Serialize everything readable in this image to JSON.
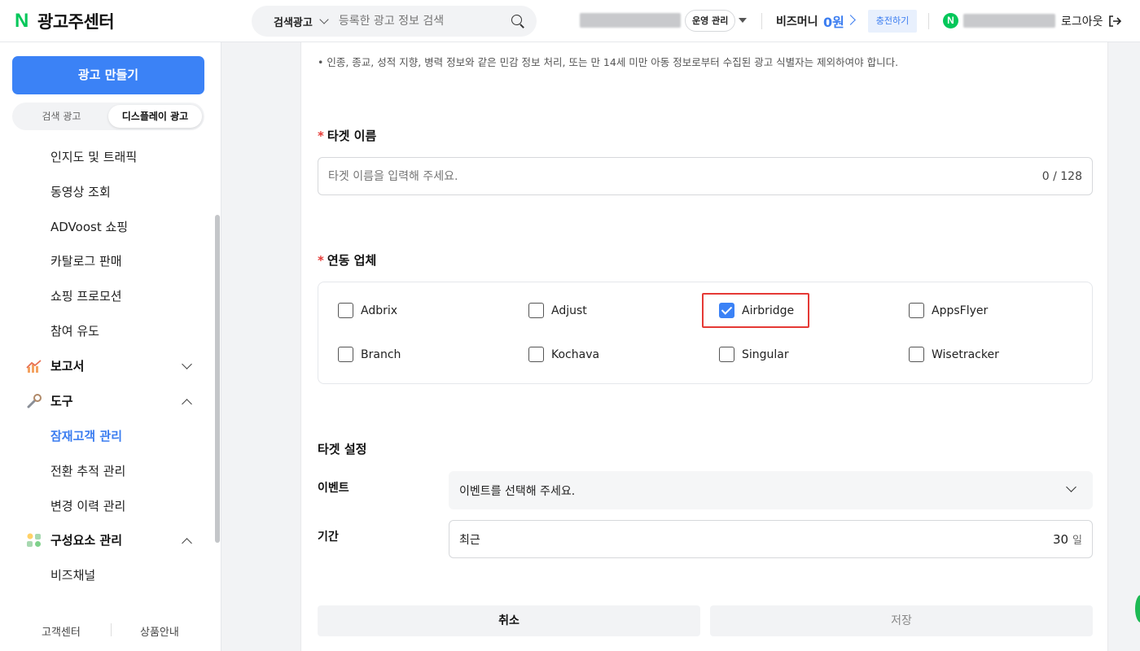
{
  "header": {
    "logo_text": "광고주센터",
    "search_type": "검색광고",
    "search_placeholder": "등록한 광고 정보 검색",
    "ops_label": "운영 관리",
    "bizmoney_label": "비즈머니",
    "bizmoney_amount": "0원",
    "charge_label": "충전하기",
    "logout_label": "로그아웃"
  },
  "sidebar": {
    "create_label": "광고 만들기",
    "tabs": [
      {
        "label": "검색 광고",
        "active": false
      },
      {
        "label": "디스플레이 광고",
        "active": true
      }
    ],
    "items_top": [
      "인지도 및 트래픽",
      "동영상 조회",
      "ADVoost 쇼핑",
      "카탈로그 판매",
      "쇼핑 프로모션",
      "참여 유도"
    ],
    "group_report": "보고서",
    "group_tools": "도구",
    "tools_items": [
      "잠재고객 관리",
      "전환 추적 관리",
      "변경 이력 관리"
    ],
    "active_item": "잠재고객 관리",
    "group_components": "구성요소 관리",
    "components_items": [
      "비즈채널"
    ],
    "footer": [
      "고객센터",
      "상품안내"
    ]
  },
  "content": {
    "note": "• 인종, 종교, 성적 지향, 병력 정보와 같은 민감 정보 처리, 또는 만 14세 미만 아동 정보로부터 수집된 광고 식별자는 제외하여야 합니다.",
    "target_name_label": "타겟 이름",
    "target_name_placeholder": "타겟 이름을 입력해 주세요.",
    "target_name_counter": "0 / 128",
    "vendor_label": "연동 업체",
    "vendors": [
      {
        "name": "Adbrix",
        "checked": false
      },
      {
        "name": "Adjust",
        "checked": false
      },
      {
        "name": "Airbridge",
        "checked": true
      },
      {
        "name": "AppsFlyer",
        "checked": false
      },
      {
        "name": "Branch",
        "checked": false
      },
      {
        "name": "Kochava",
        "checked": false
      },
      {
        "name": "Singular",
        "checked": false
      },
      {
        "name": "Wisetracker",
        "checked": false
      }
    ],
    "target_settings_label": "타겟 설정",
    "event_label": "이벤트",
    "event_placeholder": "이벤트를 선택해 주세요.",
    "period_label": "기간",
    "period_prefix": "최근",
    "period_days": "30",
    "period_unit": "일",
    "cancel_label": "취소",
    "save_label": "저장"
  },
  "colors": {
    "accent": "#3b82f6",
    "brand_green": "#03c75a",
    "required": "#e53935"
  }
}
